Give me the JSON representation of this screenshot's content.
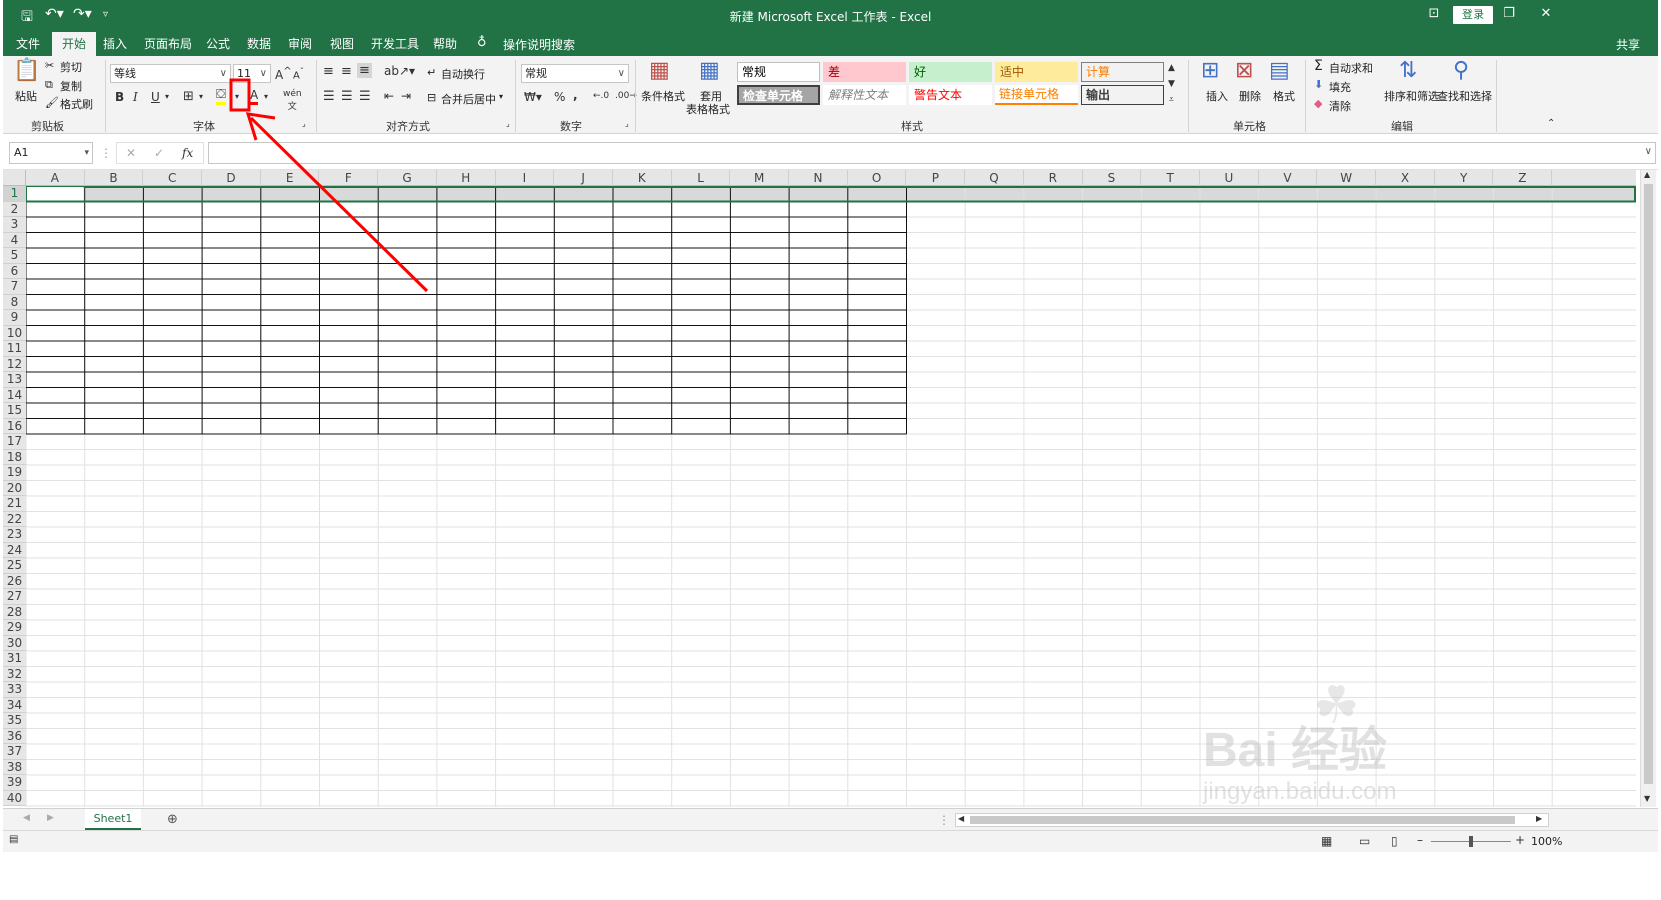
{
  "titlebar": {
    "title": "新建 Microsoft Excel 工作表 - Excel",
    "login": "登录"
  },
  "tabs": [
    "文件",
    "开始",
    "插入",
    "页面布局",
    "公式",
    "数据",
    "审阅",
    "视图",
    "开发工具",
    "帮助"
  ],
  "tell_me": "操作说明搜索",
  "share": "共享",
  "ribbon": {
    "clipboard": {
      "paste": "粘贴",
      "cut": "剪切",
      "copy": "复制",
      "format_painter": "格式刷",
      "label": "剪贴板"
    },
    "font": {
      "name": "等线",
      "size": "11",
      "bold": "B",
      "italic": "I",
      "underline": "U",
      "label": "字体"
    },
    "alignment": {
      "wrap": "自动换行",
      "merge": "合并后居中",
      "label": "对齐方式"
    },
    "number": {
      "format": "常规",
      "percent": "%",
      "comma": ",",
      "label": "数字"
    },
    "styles": {
      "conditional": "条件格式",
      "table_l1": "套用",
      "table_l2": "表格格式",
      "cells": [
        "常规",
        "差",
        "好",
        "适中",
        "计算",
        "检查单元格",
        "解释性文本",
        "警告文本",
        "链接单元格",
        "输出"
      ],
      "label": "样式"
    },
    "cells_group": {
      "insert": "插入",
      "delete": "删除",
      "format": "格式",
      "label": "单元格"
    },
    "editing": {
      "autosum": "自动求和",
      "fill": "填充",
      "clear": "清除",
      "sort": "排序和筛选",
      "find": "查找和选择",
      "label": "编辑"
    }
  },
  "formula": {
    "namebox": "A1",
    "fx": "fx"
  },
  "columns": [
    "A",
    "B",
    "C",
    "D",
    "E",
    "F",
    "G",
    "H",
    "I",
    "J",
    "K",
    "L",
    "M",
    "N",
    "O",
    "P",
    "Q",
    "R",
    "S",
    "T",
    "U",
    "V",
    "W",
    "X",
    "Y",
    "Z"
  ],
  "rows": [
    "1",
    "2",
    "3",
    "4",
    "5",
    "6",
    "7",
    "8",
    "9",
    "10",
    "11",
    "12",
    "13",
    "14",
    "15",
    "16",
    "17",
    "18",
    "19",
    "20",
    "21",
    "22",
    "23",
    "24",
    "25",
    "26",
    "27",
    "28",
    "29",
    "30",
    "31",
    "32",
    "33",
    "34",
    "35",
    "36",
    "37",
    "38",
    "39",
    "40"
  ],
  "sheet_tab": "Sheet1",
  "status": {
    "zoom": "100%"
  },
  "watermark": {
    "brand": "Bai 经验",
    "url": "jingyan.baidu.com"
  },
  "colors": {
    "accent": "#217346",
    "annotation": "#ff0000"
  }
}
